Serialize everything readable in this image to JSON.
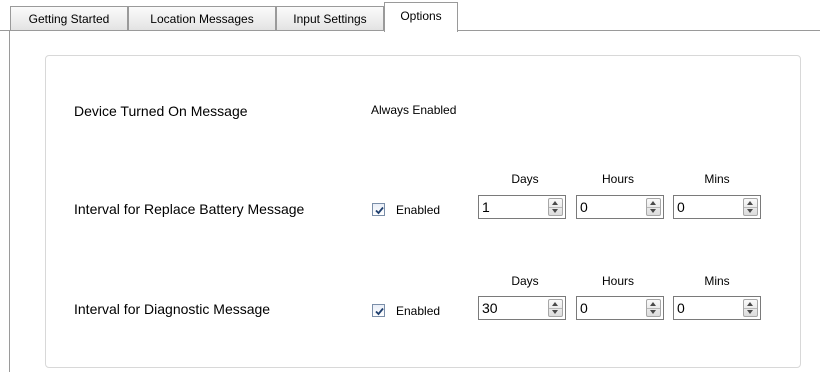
{
  "tabs": [
    {
      "label": "Getting Started",
      "active": false
    },
    {
      "label": "Location Messages",
      "active": false
    },
    {
      "label": "Input Settings",
      "active": false
    },
    {
      "label": "Options",
      "active": true
    }
  ],
  "device_on": {
    "label": "Device Turned On Message",
    "status": "Always Enabled"
  },
  "battery": {
    "label": "Interval for Replace Battery Message",
    "enabled_label": "Enabled",
    "enabled": true,
    "days_label": "Days",
    "hours_label": "Hours",
    "mins_label": "Mins",
    "days": "1",
    "hours": "0",
    "mins": "0"
  },
  "diagnostic": {
    "label": "Interval for Diagnostic Message",
    "enabled_label": "Enabled",
    "enabled": true,
    "days_label": "Days",
    "hours_label": "Hours",
    "mins_label": "Mins",
    "days": "30",
    "hours": "0",
    "mins": "0"
  },
  "icons": {
    "check": "checkmark-icon",
    "spin_up": "spin-up-arrow-icon",
    "spin_down": "spin-down-arrow-icon"
  }
}
